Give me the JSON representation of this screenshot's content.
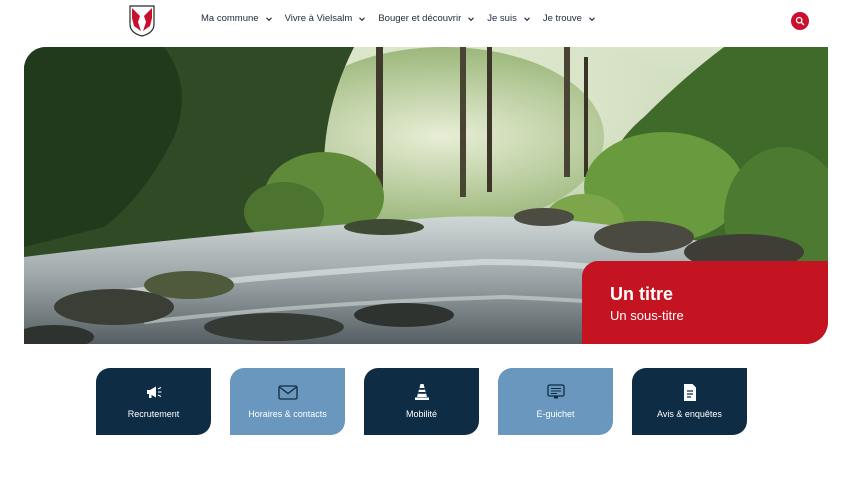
{
  "nav": {
    "items": [
      {
        "label": "Ma commune"
      },
      {
        "label": "Vivre à Vielsalm"
      },
      {
        "label": "Bouger et découvrir"
      },
      {
        "label": "Je suis"
      },
      {
        "label": "Je trouve"
      }
    ]
  },
  "hero": {
    "title": "Un titre",
    "subtitle": "Un sous-titre"
  },
  "tiles": [
    {
      "label": "Recrutement",
      "icon": "megaphone-icon",
      "style": "dark"
    },
    {
      "label": "Horaires & contacts",
      "icon": "envelope-icon",
      "style": "light"
    },
    {
      "label": "Mobilité",
      "icon": "traffic-cone-icon",
      "style": "dark"
    },
    {
      "label": "E-guichet",
      "icon": "monitor-icon",
      "style": "light"
    },
    {
      "label": "Avis & enquêtes",
      "icon": "document-icon",
      "style": "dark"
    }
  ],
  "colors": {
    "accent_red": "#c41321",
    "navy": "#0f2c45",
    "steel_blue": "#6a97bd"
  }
}
